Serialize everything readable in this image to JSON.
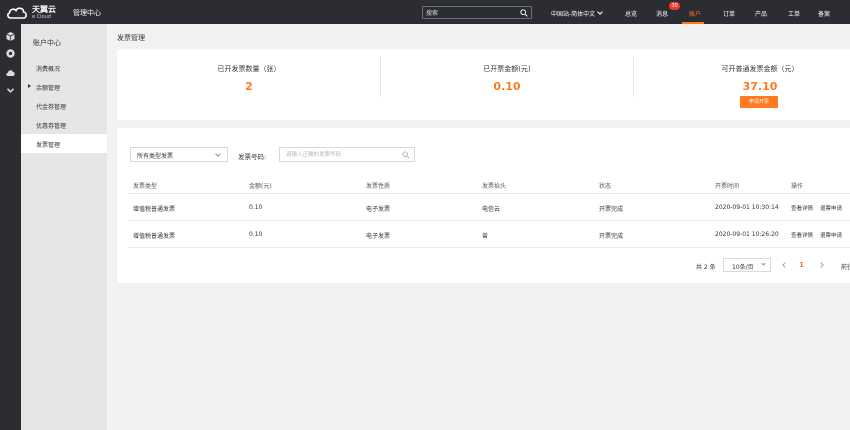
{
  "header": {
    "logo_cn": "天翼云",
    "logo_en": "e Cloud",
    "mgmt_center": "管理中心",
    "search_placeholder": "搜索",
    "region": "中国站-简体中文",
    "nav": {
      "overview": "总览",
      "messages": "消息",
      "messages_badge": "30",
      "account": "账户",
      "orders": "订单",
      "products": "产品",
      "tickets": "工单",
      "filing": "备案"
    }
  },
  "sidebar": {
    "title": "账户中心",
    "items": [
      {
        "label": "消费概况"
      },
      {
        "label": "余额管理"
      },
      {
        "label": "代金券管理"
      },
      {
        "label": "优惠券管理"
      },
      {
        "label": "发票管理"
      }
    ]
  },
  "main": {
    "title": "发票管理",
    "stats": [
      {
        "label": "已开发票数量（张）",
        "value": "2"
      },
      {
        "label": "已开票金额(元)",
        "value": "0.10"
      },
      {
        "label": "可开普通发票金额（元）",
        "value": "37.10"
      }
    ],
    "apply_button": "申请开票",
    "filter": {
      "type_select": "所有类型发票",
      "number_label": "发票号码:",
      "number_placeholder": "请输入正确的发票号码"
    },
    "table": {
      "headers": [
        "发票类型",
        "金额(元)",
        "发票性质",
        "发票抬头",
        "状态",
        "开票时间",
        "操作"
      ],
      "rows": [
        {
          "type": "增值税普通发票",
          "amount": "0.10",
          "nature": "电子发票",
          "header": "电信云",
          "status": "开票完成",
          "time": "2020-09-01 10:30:14",
          "action1": "查看详情",
          "action2": "退票申请"
        },
        {
          "type": "增值税普通发票",
          "amount": "0.10",
          "nature": "电子发票",
          "header": "曾",
          "status": "开票完成",
          "time": "2020-09-01 10:26:20",
          "action1": "查看详情",
          "action2": "退票申请"
        }
      ]
    },
    "pager": {
      "total": "共 2 条",
      "page_size": "10条/页",
      "current": "1",
      "goto": "前往"
    }
  },
  "colors": {
    "accent": "#ff7a1f",
    "topbar": "#2b2d33",
    "badge": "#f03c28"
  }
}
